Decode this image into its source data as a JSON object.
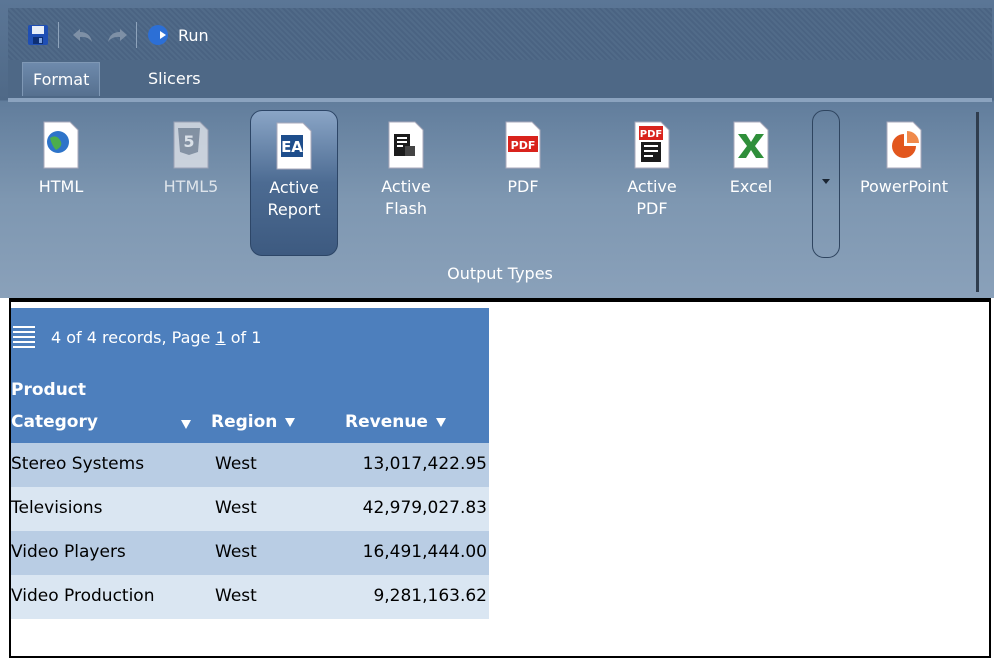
{
  "toolbar": {
    "run_label": "Run",
    "icons": [
      "save-icon",
      "undo-icon",
      "redo-icon",
      "run-icon"
    ]
  },
  "tabs": [
    {
      "label": "Format",
      "active": true
    },
    {
      "label": "Slicers",
      "active": false
    }
  ],
  "ribbon": {
    "group_label": "Output Types",
    "buttons": [
      {
        "line1": "HTML",
        "line2": ""
      },
      {
        "line1": "HTML5",
        "line2": ""
      },
      {
        "line1": "Active",
        "line2": "Report"
      },
      {
        "line1": "Active",
        "line2": "Flash"
      },
      {
        "line1": "PDF",
        "line2": ""
      },
      {
        "line1": "Active",
        "line2": "PDF"
      },
      {
        "line1": "Excel",
        "line2": ""
      },
      {
        "line1": "PowerPoint",
        "line2": ""
      }
    ],
    "selected": "Active Report"
  },
  "report": {
    "records_prefix": "4 of 4 records, Page ",
    "page": "1",
    "records_suffix": " of 1",
    "columns": [
      {
        "line1": "Product",
        "line2": "Category"
      },
      {
        "line1": "",
        "line2": "Region"
      },
      {
        "line1": "",
        "line2": "Revenue"
      }
    ],
    "rows": [
      {
        "category": "Stereo Systems",
        "region": "West",
        "revenue": "13,017,422.95"
      },
      {
        "category": "Televisions",
        "region": "West",
        "revenue": "42,979,027.83"
      },
      {
        "category": "Video Players",
        "region": "West",
        "revenue": "16,491,444.00"
      },
      {
        "category": "Video Production",
        "region": "West",
        "revenue": "9,281,163.62"
      }
    ]
  },
  "colors": {
    "ribbon": "#5b7696",
    "report_header": "#4d7fbd",
    "row_dark": "#b9cde4",
    "row_light": "#dae6f2"
  }
}
